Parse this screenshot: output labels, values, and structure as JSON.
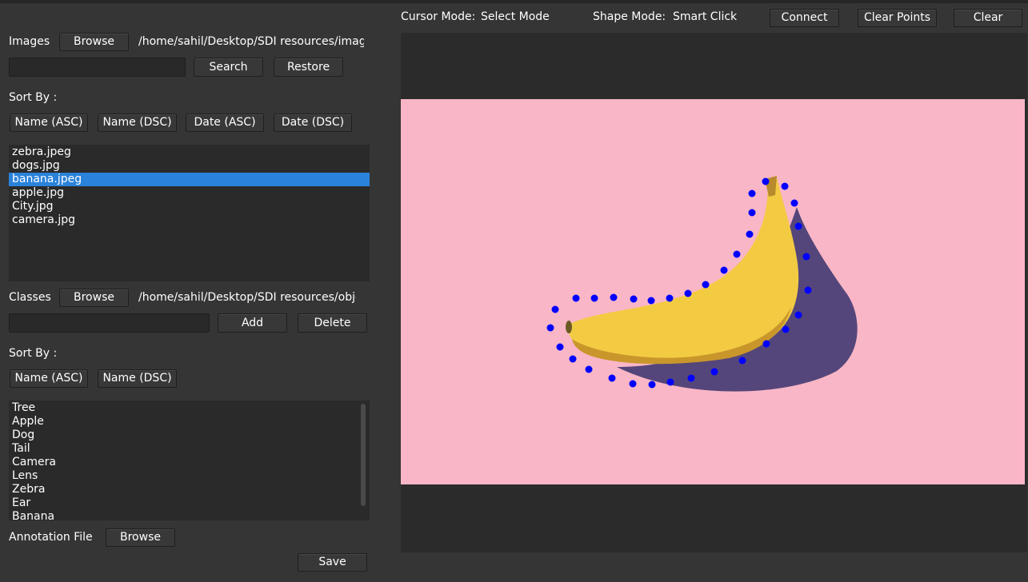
{
  "toolbar": {
    "cursor_mode_label": "Cursor Mode:",
    "cursor_mode_value": "Select Mode",
    "shape_mode_label": "Shape Mode:",
    "shape_mode_value": "Smart Click",
    "connect_label": "Connect",
    "clear_points_label": "Clear Points",
    "clear_label": "Clear"
  },
  "images": {
    "label": "Images",
    "browse_label": "Browse",
    "path": "/home/sahil/Desktop/SDI resources/imag",
    "search_value": "",
    "search_label": "Search",
    "restore_label": "Restore",
    "sort_by_label": "Sort By :",
    "sort_buttons": [
      "Name (ASC)",
      "Name (DSC)",
      "Date (ASC)",
      "Date (DSC)"
    ],
    "files": [
      "zebra.jpeg",
      "dogs.jpg",
      "banana.jpeg",
      "apple.jpg",
      "City.jpg",
      "camera.jpg"
    ],
    "selected_file": "banana.jpeg"
  },
  "classes": {
    "label": "Classes",
    "browse_label": "Browse",
    "path": "/home/sahil/Desktop/SDI resources/obje",
    "input_value": "",
    "add_label": "Add",
    "delete_label": "Delete",
    "sort_by_label": "Sort By :",
    "sort_buttons": [
      "Name (ASC)",
      "Name (DSC)"
    ],
    "items": [
      "Tree",
      "Apple",
      "Dog",
      "Tail",
      "Camera",
      "Lens",
      "Zebra",
      "Ear",
      "Banana"
    ]
  },
  "annotation": {
    "label": "Annotation File",
    "browse_label": "Browse",
    "save_label": "Save"
  },
  "colors": {
    "image_background": "#f9b6c6",
    "annotation_points": "#0000ff",
    "selection": "#2a82da"
  },
  "annotation_points": {
    "count": 40,
    "marker_shape": "filled-circle",
    "color_name": "blue"
  }
}
